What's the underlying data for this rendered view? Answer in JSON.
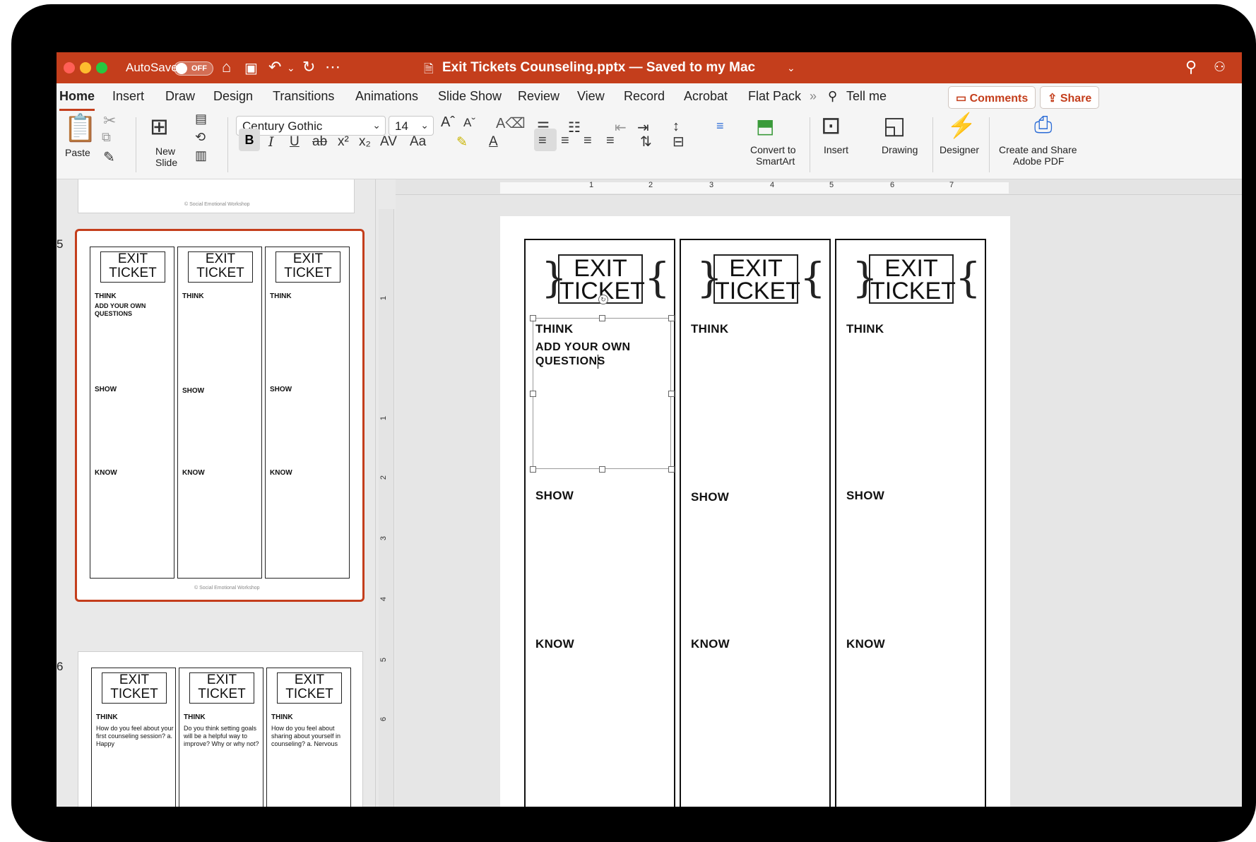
{
  "titlebar": {
    "autosave_label": "AutoSave",
    "autosave_state": "OFF",
    "doc_title": "Exit Tickets Counseling.pptx — Saved to my Mac",
    "accent": "#c43e1c"
  },
  "tabs": [
    "Home",
    "Insert",
    "Draw",
    "Design",
    "Transitions",
    "Animations",
    "Slide Show",
    "Review",
    "View",
    "Record",
    "Acrobat",
    "Flat Pack"
  ],
  "tell_me": "Tell me",
  "comments_label": "Comments",
  "share_label": "Share",
  "ribbon": {
    "paste": "Paste",
    "new_slide_1": "New",
    "new_slide_2": "Slide",
    "font_name": "Century Gothic",
    "font_size": "14",
    "convert_1": "Convert to",
    "convert_2": "SmartArt",
    "insert": "Insert",
    "drawing": "Drawing",
    "designer": "Designer",
    "create_1": "Create and Share",
    "create_2": "Adobe PDF"
  },
  "slide_panel": {
    "prev_footer": "© Social Emotional Workshop",
    "slide5_num": "5",
    "slide6_num": "6",
    "slide5_footer": "© Social Emotional Workshop",
    "ticket_1": "EXIT",
    "ticket_2": "TICKET",
    "think": "THINK",
    "show": "SHOW",
    "know": "KNOW",
    "slide5_col1_text": "ADD YOUR OWN QUESTIONS",
    "slide6_col1_text": "How do you feel about your first counseling session? a. Happy",
    "slide6_col2_text": "Do you think setting goals will be a helpful way to improve? Why or why not?",
    "slide6_col3_text": "How do you feel about sharing about yourself in counseling? a. Nervous"
  },
  "ruler": {
    "h": [
      "1",
      "2",
      "3",
      "4",
      "5",
      "6",
      "7"
    ],
    "v": [
      "1",
      "1",
      "2",
      "3",
      "4",
      "5",
      "6"
    ]
  },
  "slide": {
    "ticket_1": "EXIT",
    "ticket_2": "TICKET",
    "think": "THINK",
    "show": "SHOW",
    "know": "KNOW",
    "col1_text_1": "ADD YOUR OWN",
    "col1_text_2": "QUESTIONS"
  }
}
